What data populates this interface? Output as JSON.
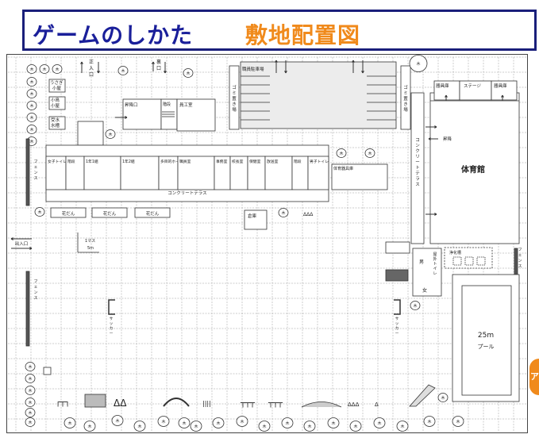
{
  "header": {
    "title": "ゲームのしかた",
    "subtitle": "敷地配置図"
  },
  "labels": {
    "main_gate": [
      "正",
      "入",
      "口"
    ],
    "back_gate": [
      "裏",
      "口"
    ],
    "rabbit_hut": "うさぎ小屋",
    "bird_hut": "小鳥小屋",
    "water_tank": "受水水槽",
    "staff_parking": "職員駐車場",
    "garbage_left": "ゴミ置き場",
    "garbage_right": "ゴミ置き場",
    "equipment_room": "器具庫",
    "stage": "ステージ",
    "equipment_room2": "器具庫",
    "entrance_hall": "昇降口",
    "shelf1": "階段",
    "workroom": "員工室",
    "stairs_label": "階段",
    "girls_toilet": "女子トイレ",
    "shelf2": "階段",
    "class_1_1": "1年1組",
    "class_1_2": "1年2組",
    "staff_room": "職員室",
    "multipurpose_hall": "多目的ホール",
    "office": "事務室",
    "principal": "校長室",
    "nurse": "保健室",
    "broadcast": "放送室",
    "stairs3": "階段",
    "boys_toilet": "男子トイレ",
    "gym_storage": "体育器具庫",
    "concrete_terrace": "コンクリートテラス",
    "gym_terrace": "コンクリートテラス",
    "gym": "体育館",
    "entrance_gym": "昇降",
    "flower1": "花だん",
    "flower2": "花だん",
    "flower3": "花だん",
    "storage": "倉庫",
    "fence_left_top": "フェンス",
    "fence_left_bottom": "フェンス",
    "fence_right": "フェンス",
    "exit": "出入口",
    "one_square": "1マス",
    "five_m": "5m",
    "soccer_left": "サッカー",
    "soccer_right": "サッカー",
    "outdoor_toilet": "屋外トイレ",
    "male": "男",
    "female": "女",
    "filtration": "浄化槽",
    "pool": "25m",
    "pool_sub": "プール",
    "tree": "木",
    "tab": "ア"
  }
}
